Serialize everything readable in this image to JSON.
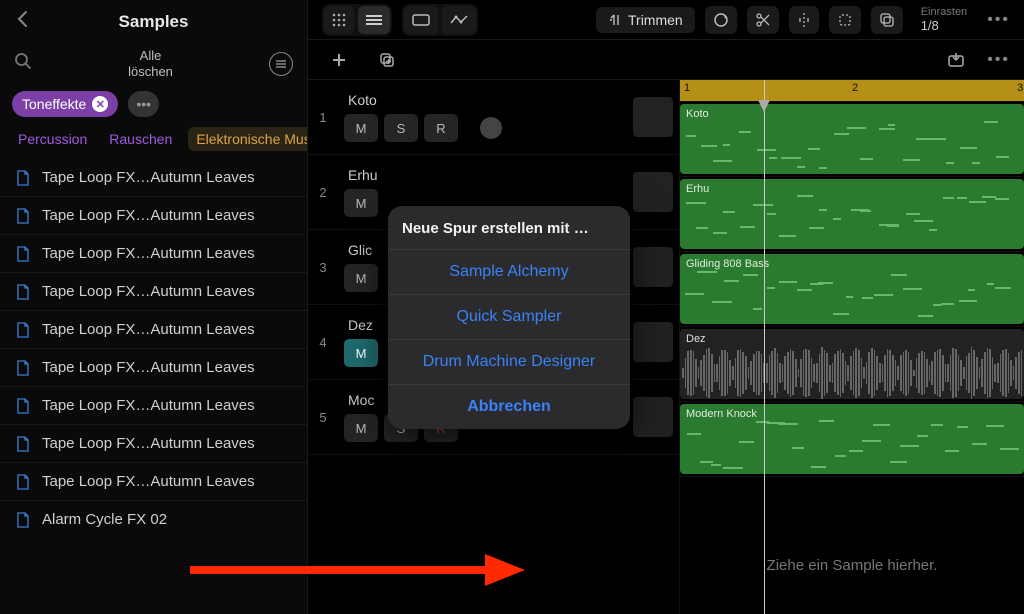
{
  "sidebar": {
    "title": "Samples",
    "clear_line1": "Alle",
    "clear_line2": "löschen",
    "tag": "Toneffekte",
    "categories": [
      "Percussion",
      "Rauschen",
      "Elektronische Mus"
    ],
    "items": [
      "Tape Loop FX…Autumn Leaves",
      "Tape Loop FX…Autumn Leaves",
      "Tape Loop FX…Autumn Leaves",
      "Tape Loop FX…Autumn Leaves",
      "Tape Loop FX…Autumn Leaves",
      "Tape Loop FX…Autumn Leaves",
      "Tape Loop FX…Autumn Leaves",
      "Tape Loop FX…Autumn Leaves",
      "Tape Loop FX…Autumn Leaves",
      "Alarm Cycle FX 02"
    ]
  },
  "toolbar": {
    "trim": "Trimmen",
    "snap_label": "Einrasten",
    "snap_value": "1/8"
  },
  "tracks": [
    {
      "num": "1",
      "name": "Koto"
    },
    {
      "num": "2",
      "name": "Erhu"
    },
    {
      "num": "3",
      "name": "Glic"
    },
    {
      "num": "4",
      "name": "Dez"
    },
    {
      "num": "5",
      "name": "Moc"
    }
  ],
  "msr": {
    "m": "M",
    "s": "S",
    "r": "R"
  },
  "clips": [
    {
      "name": "Koto"
    },
    {
      "name": "Erhu"
    },
    {
      "name": "Gliding 808 Bass"
    },
    {
      "name": "Dez"
    },
    {
      "name": "Modern Knock"
    }
  ],
  "ruler": {
    "marks": [
      "1",
      "2",
      "3"
    ]
  },
  "drop_hint": "Ziehe ein Sample hierher.",
  "popup": {
    "title": "Neue Spur erstellen mit …",
    "opt1": "Sample Alchemy",
    "opt2": "Quick Sampler",
    "opt3": "Drum Machine Designer",
    "cancel": "Abbrechen"
  }
}
